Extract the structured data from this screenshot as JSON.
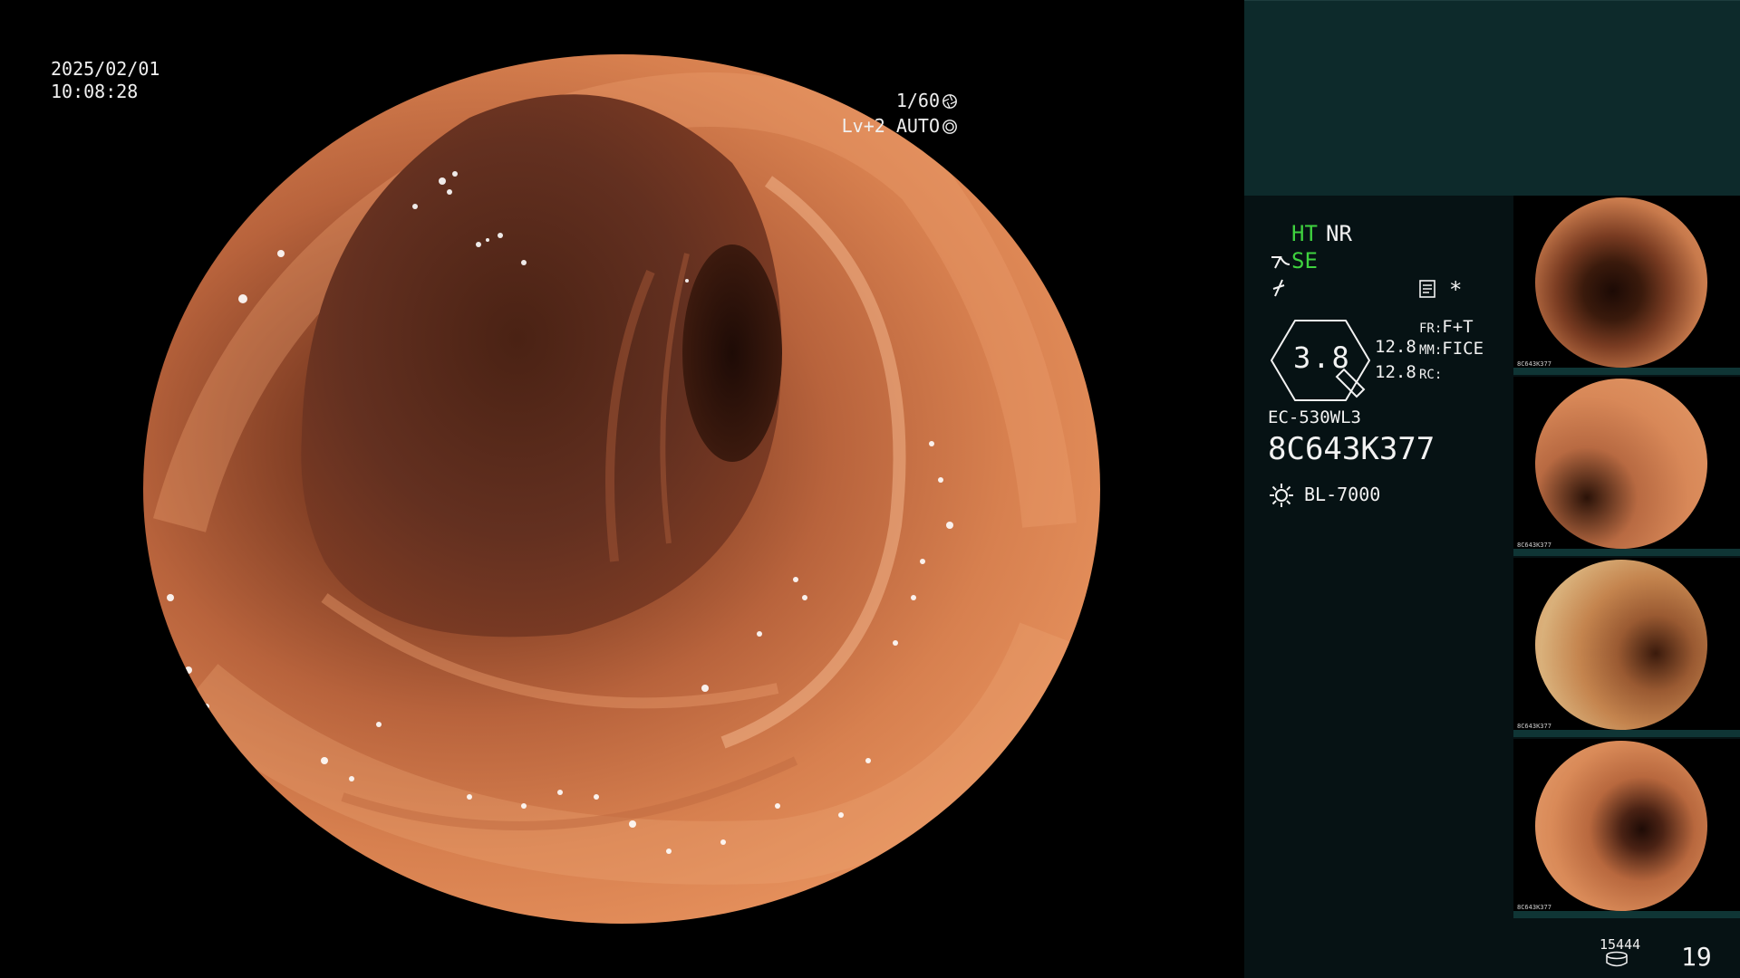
{
  "overlay": {
    "date": "2025/02/01",
    "time": "10:08:28",
    "shutter": "1/60",
    "level": "Lv+2 AUTO"
  },
  "info": {
    "mode_ht": "HT",
    "mode_nr": "NR",
    "mode_se": "SE",
    "asterisk": "*",
    "zoom_value": "3.8",
    "val_a": "12.8",
    "val_b": "12.8",
    "fr_label": "FR:",
    "fr_value": "F+T",
    "mm_label": "MM:",
    "mm_value": "FICE",
    "rc_label": "RC:",
    "rc_value": "",
    "scope_model": "EC-530WL3",
    "scope_serial": "8C643K377",
    "light_source": "BL-7000",
    "record_count": "15444",
    "image_number": "19"
  },
  "icons": {
    "shutter": "aperture-icon",
    "level": "ring-icon",
    "scope_arrow": "scope-arrow-icon",
    "freeze": "freeze-icon",
    "memo": "memo-icon",
    "light": "light-icon",
    "record": "database-icon"
  },
  "colors": {
    "panel_bg": "#061214",
    "header_bg": "#0d2a2b",
    "status_green": "#3fd23f",
    "mucosa": "#d7804f",
    "lumen": "#5a2a18"
  },
  "thumbnails": [
    {
      "serial": "8C643K377"
    },
    {
      "serial": "8C643K377"
    },
    {
      "serial": "8C643K377"
    },
    {
      "serial": "8C643K377"
    }
  ]
}
